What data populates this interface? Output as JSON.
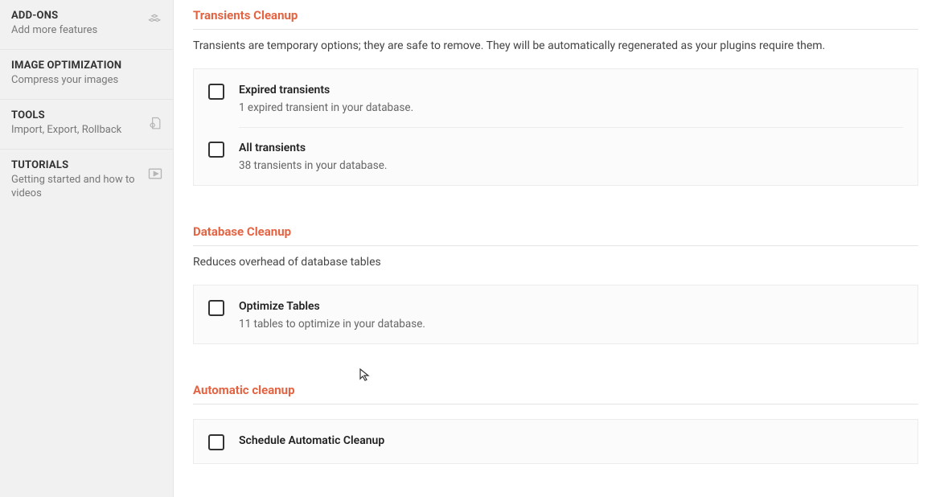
{
  "sidebar": {
    "items": [
      {
        "title": "ADD-ONS",
        "sub": "Add more features",
        "icon": "boxes-icon"
      },
      {
        "title": "IMAGE OPTIMIZATION",
        "sub": "Compress your images",
        "icon": ""
      },
      {
        "title": "TOOLS",
        "sub": "Import, Export, Rollback",
        "icon": "file-gear-icon"
      },
      {
        "title": "TUTORIALS",
        "sub": "Getting started and how to videos",
        "icon": "play-icon"
      }
    ]
  },
  "sections": {
    "transients": {
      "title": "Transients Cleanup",
      "desc": "Transients are temporary options; they are safe to remove. They will be automatically regenerated as your plugins require them.",
      "rows": [
        {
          "title": "Expired transients",
          "sub": "1 expired transient in your database."
        },
        {
          "title": "All transients",
          "sub": "38 transients in your database."
        }
      ]
    },
    "database": {
      "title": "Database Cleanup",
      "desc": "Reduces overhead of database tables",
      "rows": [
        {
          "title": "Optimize Tables",
          "sub": "11 tables to optimize in your database."
        }
      ]
    },
    "automatic": {
      "title": "Automatic cleanup",
      "rows": [
        {
          "title": "Schedule Automatic Cleanup"
        }
      ]
    }
  }
}
